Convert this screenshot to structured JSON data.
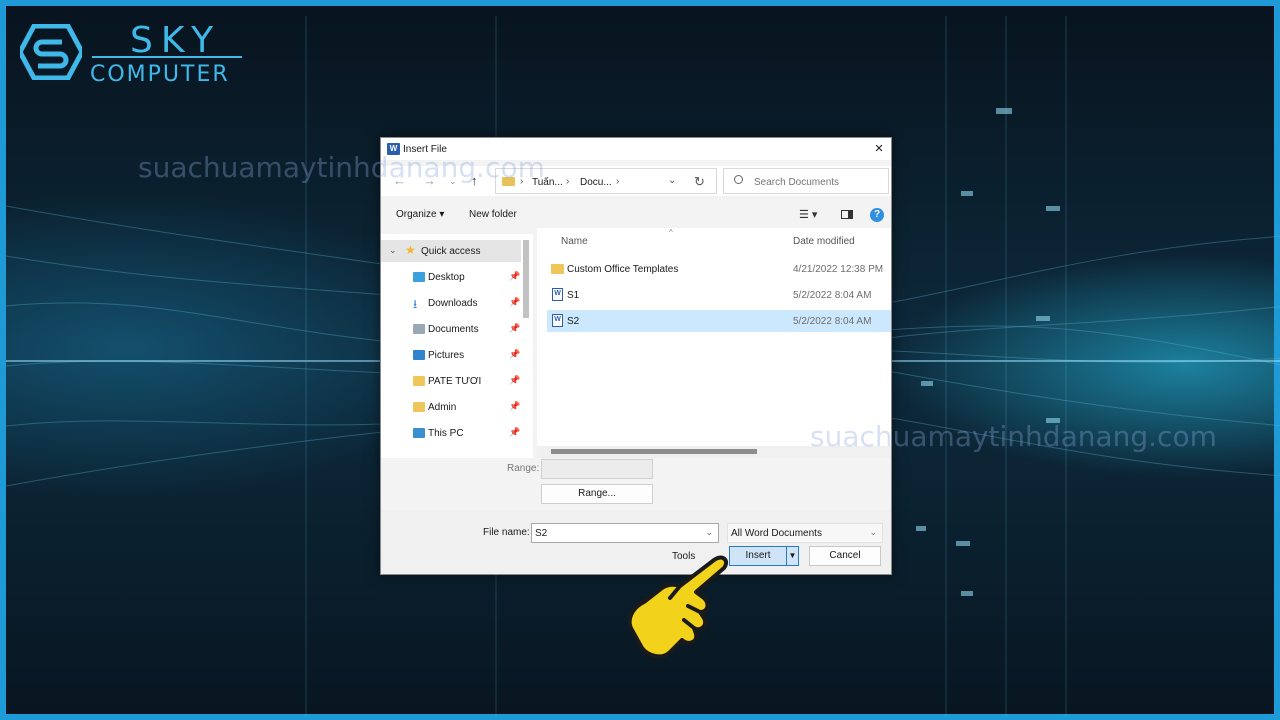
{
  "logo": {
    "line1": "SKY",
    "line2": "COMPUTER"
  },
  "watermarks": [
    "suachuamaytinhdanang.com",
    "suachuamaytinhdanang.com"
  ],
  "dialog": {
    "title": "Insert File",
    "address": {
      "segments": [
        "Tuấn...",
        "Docu..."
      ]
    },
    "search": {
      "placeholder": "Search Documents"
    },
    "toolbar": {
      "organize": "Organize ▾",
      "new_folder": "New folder",
      "help": "?"
    },
    "tree": [
      {
        "label": "Quick access",
        "icon": "star-icon"
      },
      {
        "label": "Desktop",
        "icon": "desktop-icon",
        "pinned": true
      },
      {
        "label": "Downloads",
        "icon": "download-icon",
        "pinned": true
      },
      {
        "label": "Documents",
        "icon": "documents-icon",
        "pinned": true
      },
      {
        "label": "Pictures",
        "icon": "pictures-icon",
        "pinned": true
      },
      {
        "label": "PATE TƯƠI",
        "icon": "folder-icon",
        "pinned": true
      },
      {
        "label": "Admin",
        "icon": "folder-icon",
        "pinned": true
      },
      {
        "label": "This PC",
        "icon": "pc-icon",
        "pinned": true
      }
    ],
    "columns": {
      "name": "Name",
      "date": "Date modified"
    },
    "files": [
      {
        "name": "Custom Office Templates",
        "date": "4/21/2022 12:38 PM",
        "type": "folder"
      },
      {
        "name": "S1",
        "date": "5/2/2022 8:04 AM",
        "type": "word"
      },
      {
        "name": "S2",
        "date": "5/2/2022 8:04 AM",
        "type": "word",
        "selected": true
      }
    ],
    "range_label": "Range:",
    "range_button": "Range...",
    "file_name_label": "File name:",
    "file_name_value": "S2",
    "filter": "All Word Documents",
    "tools": "Tools",
    "insert": "Insert",
    "cancel": "Cancel"
  },
  "colors": {
    "accent": "#2a78c8",
    "selection": "#cce8ff",
    "brand": "#3fb8ea"
  }
}
